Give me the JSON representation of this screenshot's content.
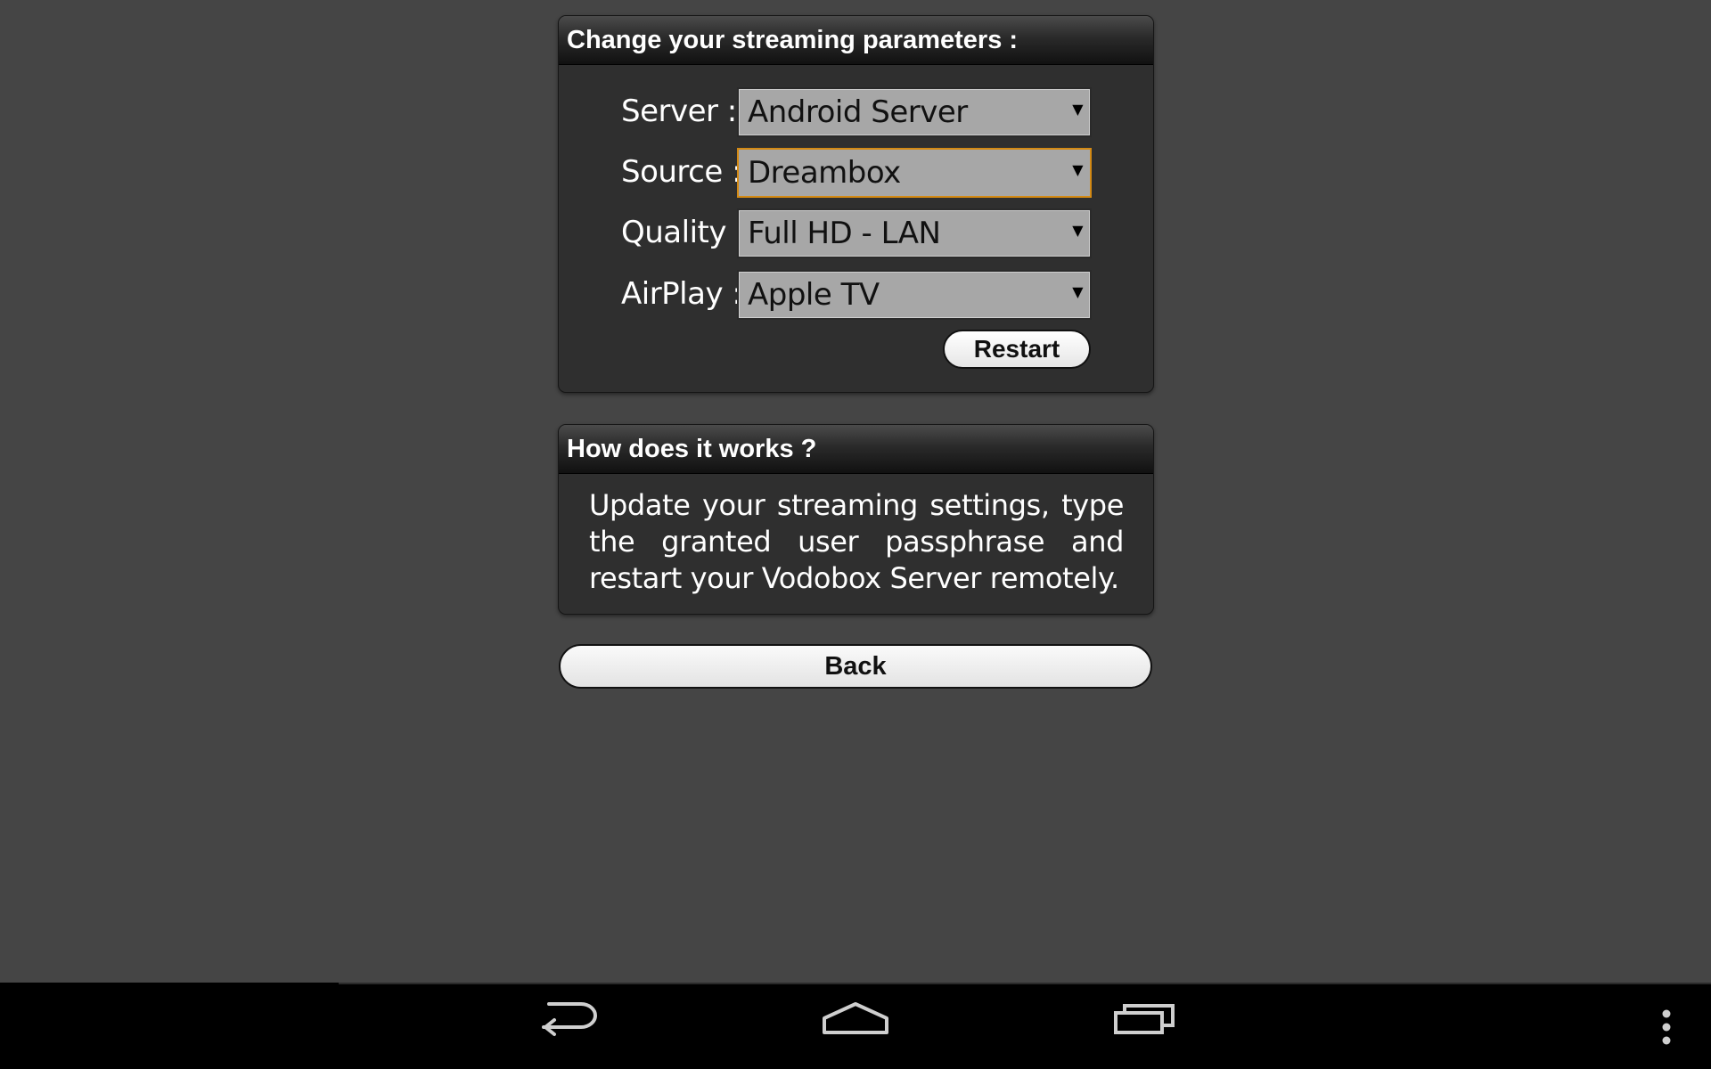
{
  "settings": {
    "title": "Change your streaming parameters :",
    "fields": [
      {
        "label": "Server  :",
        "value": "Android Server",
        "focused": false
      },
      {
        "label": "Source :",
        "value": "Dreambox",
        "focused": true
      },
      {
        "label": "Quality :",
        "value": "Full HD - LAN",
        "focused": false
      },
      {
        "label": "AirPlay :",
        "value": "Apple TV",
        "focused": false
      }
    ],
    "restart_label": "Restart"
  },
  "help": {
    "title": "How does it works ?",
    "text": "Update your streaming settings, type the granted user passphrase and restart your Vodobox Server remotely."
  },
  "back_label": "Back",
  "navigation": {
    "icons": [
      "back-icon",
      "home-icon",
      "recent-apps-icon",
      "overflow-menu-icon"
    ]
  },
  "colors": {
    "background": "#454545",
    "panel": "#2f2f2f",
    "select": "#a7a7a7",
    "focus_border": "#d48a14",
    "nav_bar": "#000000"
  }
}
